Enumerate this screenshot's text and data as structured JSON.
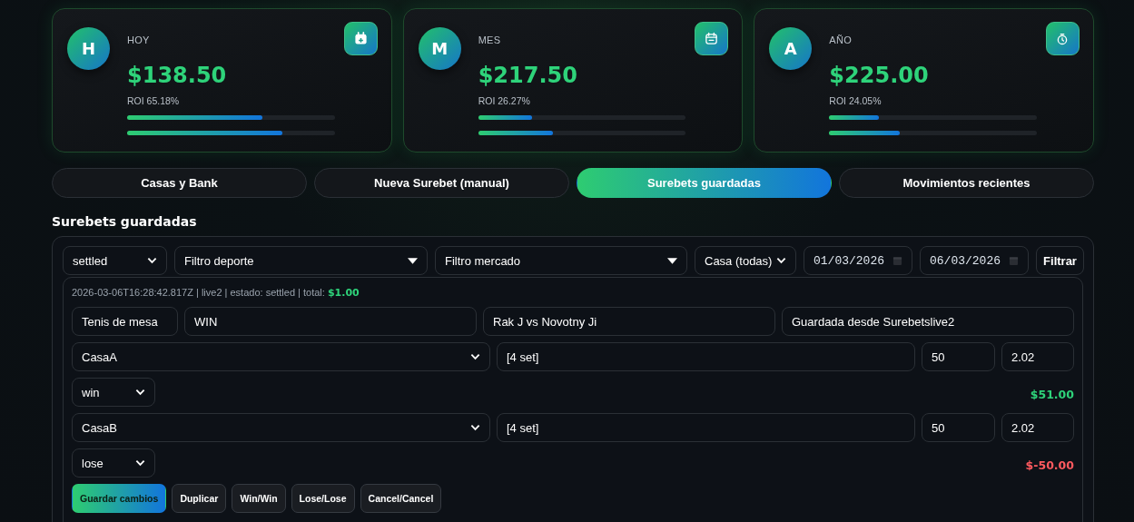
{
  "stats": [
    {
      "avatar": "H",
      "label": "HOY",
      "amount": "$138.50",
      "roi": "ROI 65.18%",
      "bars": [
        {
          "level": 0.65
        },
        {
          "level": 0.75
        }
      ]
    },
    {
      "avatar": "M",
      "label": "MES",
      "amount": "$217.50",
      "roi": "ROI 26.27%",
      "bars": [
        {
          "level": 0.26
        },
        {
          "level": 0.36
        }
      ]
    },
    {
      "avatar": "A",
      "label": "AÑO",
      "amount": "$225.00",
      "roi": "ROI 24.05%",
      "bars": [
        {
          "level": 0.24
        },
        {
          "level": 0.34
        }
      ]
    }
  ],
  "tabs": [
    {
      "label": "Casas y Bank",
      "selected": false
    },
    {
      "label": "Nueva Surebet (manual)",
      "selected": false
    },
    {
      "label": "Surebets guardadas",
      "selected": true
    },
    {
      "label": "Movimientos recientes",
      "selected": false
    }
  ],
  "section_title": "Surebets guardadas",
  "filters": [
    {
      "kind": "select",
      "value": "settled"
    },
    {
      "kind": "dropdown",
      "value": "Filtro deporte"
    },
    {
      "kind": "dropdown",
      "value": "Filtro mercado"
    },
    {
      "kind": "select",
      "value": "Casa (todas)"
    },
    {
      "kind": "date",
      "value": "01/03/2026"
    },
    {
      "kind": "date",
      "value": "06/03/2026"
    },
    {
      "kind": "button",
      "value": "Filtrar"
    }
  ],
  "surebet": {
    "meta": "2026-03-06T16:28:42.817Z | live2 | estado: settled | total: ",
    "total": "$1.00",
    "sport": "Tenis de mesa",
    "market": "WIN",
    "event": "Rak J vs Novotny Ji",
    "note": "Guardada desde Surebetslive2",
    "legs": [
      {
        "casa": "CasaA",
        "selection": "[4 set]",
        "stake": "50",
        "odds": "2.02",
        "result": "win",
        "profit": "$51.00",
        "positive": true
      },
      {
        "casa": "CasaB",
        "selection": "[4 set]",
        "stake": "50",
        "odds": "2.02",
        "result": "lose",
        "profit": "$-50.00",
        "positive": false
      }
    ],
    "actions": [
      {
        "label": "Guardar cambios",
        "primary": true
      },
      {
        "label": "Duplicar",
        "primary": false
      },
      {
        "label": "Win/Win",
        "primary": false
      },
      {
        "label": "Lose/Lose",
        "primary": false
      },
      {
        "label": "Cancel/Cancel",
        "primary": false
      }
    ]
  }
}
